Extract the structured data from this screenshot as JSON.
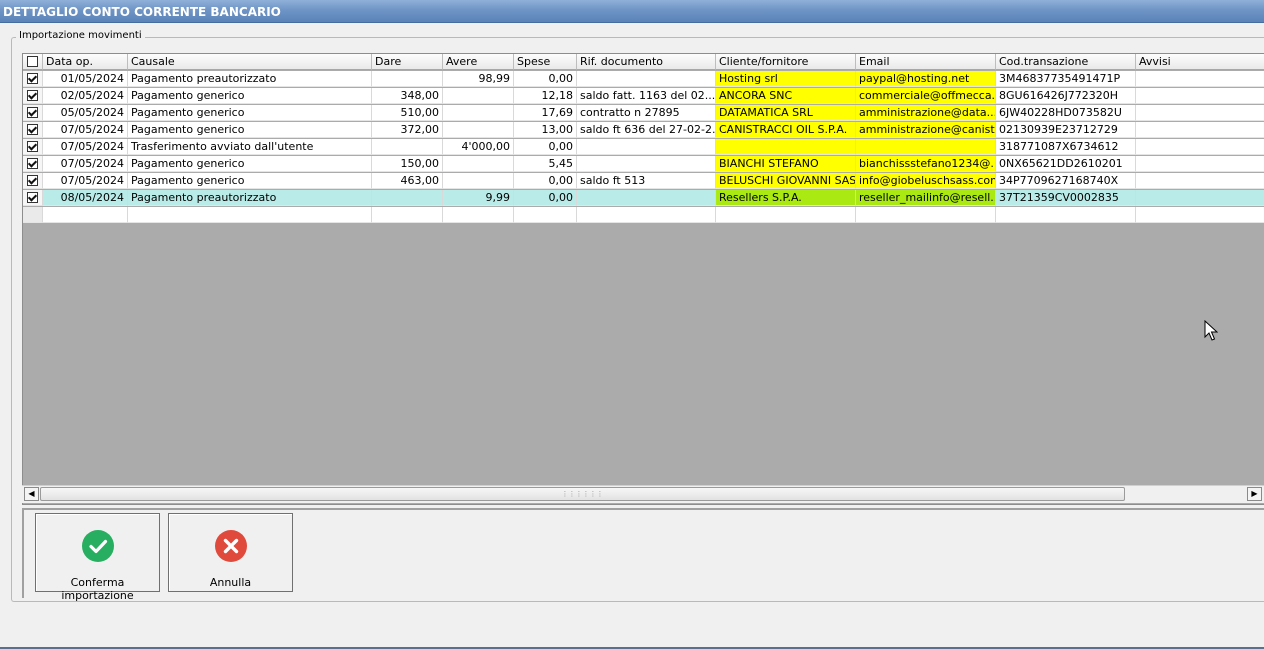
{
  "window": {
    "title": "DETTAGLIO CONTO CORRENTE BANCARIO",
    "group_label": "Importazione movimenti"
  },
  "columns": [
    {
      "key": "check",
      "label": ""
    },
    {
      "key": "data_op",
      "label": "Data op."
    },
    {
      "key": "causale",
      "label": "Causale"
    },
    {
      "key": "dare",
      "label": "Dare"
    },
    {
      "key": "avere",
      "label": "Avere"
    },
    {
      "key": "spese",
      "label": "Spese"
    },
    {
      "key": "rif_documento",
      "label": "Rif. documento"
    },
    {
      "key": "cliente_fornitore",
      "label": "Cliente/fornitore"
    },
    {
      "key": "email",
      "label": "Email"
    },
    {
      "key": "cod_transazione",
      "label": "Cod.transazione"
    },
    {
      "key": "avvisi",
      "label": "Avvisi"
    }
  ],
  "rows": [
    {
      "checked": true,
      "data_op": "01/05/2024",
      "causale": "Pagamento preautorizzato",
      "dare": "",
      "avere": "98,99",
      "spese": "0,00",
      "rif_documento": "",
      "cliente_fornitore": "Hosting srl",
      "email": "paypal@hosting.net",
      "cod_transazione": "3M46837735491471P",
      "avvisi": "",
      "highlight": "yellow",
      "selected": false
    },
    {
      "checked": true,
      "data_op": "02/05/2024",
      "causale": "Pagamento generico",
      "dare": "348,00",
      "avere": "",
      "spese": "12,18",
      "rif_documento": "saldo fatt.   1163 del 02...",
      "cliente_fornitore": "ANCORA SNC",
      "email": "commerciale@offmecca...",
      "cod_transazione": "8GU616426J772320H",
      "avvisi": "",
      "highlight": "yellow",
      "selected": false
    },
    {
      "checked": true,
      "data_op": "05/05/2024",
      "causale": "Pagamento generico",
      "dare": "510,00",
      "avere": "",
      "spese": "17,69",
      "rif_documento": "contratto n 27895",
      "cliente_fornitore": "DATAMATICA SRL",
      "email": "amministrazione@data...",
      "cod_transazione": "6JW40228HD073582U",
      "avvisi": "",
      "highlight": "yellow",
      "selected": false
    },
    {
      "checked": true,
      "data_op": "07/05/2024",
      "causale": "Pagamento generico",
      "dare": "372,00",
      "avere": "",
      "spese": "13,00",
      "rif_documento": "saldo ft 636 del 27-02-2...",
      "cliente_fornitore": "CANISTRACCI OIL S.P.A.",
      "email": "amministrazione@canist...",
      "cod_transazione": "02130939E23712729",
      "avvisi": "",
      "highlight": "yellow",
      "selected": false
    },
    {
      "checked": true,
      "data_op": "07/05/2024",
      "causale": "Trasferimento avviato dall'utente",
      "dare": "",
      "avere": "4'000,00",
      "spese": "0,00",
      "rif_documento": "",
      "cliente_fornitore": "",
      "email": "",
      "cod_transazione": "318771087X6734612",
      "avvisi": "",
      "highlight": "yellow",
      "selected": false
    },
    {
      "checked": true,
      "data_op": "07/05/2024",
      "causale": "Pagamento generico",
      "dare": "150,00",
      "avere": "",
      "spese": "5,45",
      "rif_documento": "",
      "cliente_fornitore": "BIANCHI STEFANO",
      "email": "bianchissstefano1234@...",
      "cod_transazione": "0NX65621DD2610201",
      "avvisi": "",
      "highlight": "yellow",
      "selected": false
    },
    {
      "checked": true,
      "data_op": "07/05/2024",
      "causale": "Pagamento generico",
      "dare": "463,00",
      "avere": "",
      "spese": "0,00",
      "rif_documento": "saldo ft 513",
      "cliente_fornitore": "BELUSCHI GIOVANNI SAS",
      "email": "info@giobeluschsass.com",
      "cod_transazione": "34P7709627168740X",
      "avvisi": "",
      "highlight": "yellow",
      "selected": false
    },
    {
      "checked": true,
      "data_op": "08/05/2024",
      "causale": "Pagamento preautorizzato",
      "dare": "",
      "avere": "9,99",
      "spese": "0,00",
      "rif_documento": "",
      "cliente_fornitore": "Resellers S.P.A.",
      "email": "reseller_mailinfo@resell...",
      "cod_transazione": "37T21359CV0002835",
      "avvisi": "",
      "highlight": "lime",
      "selected": true
    }
  ],
  "buttons": {
    "confirm_label": "Conferma importazione",
    "cancel_label": "Annulla"
  },
  "colors": {
    "highlight_yellow": "#ffff00",
    "highlight_lime": "#aaea12",
    "selected_row": "#b9ece9",
    "confirm_icon": "#27ae60",
    "cancel_icon": "#e04a3c"
  },
  "icons": {
    "confirm": "check-circle-icon",
    "cancel": "x-circle-icon"
  }
}
